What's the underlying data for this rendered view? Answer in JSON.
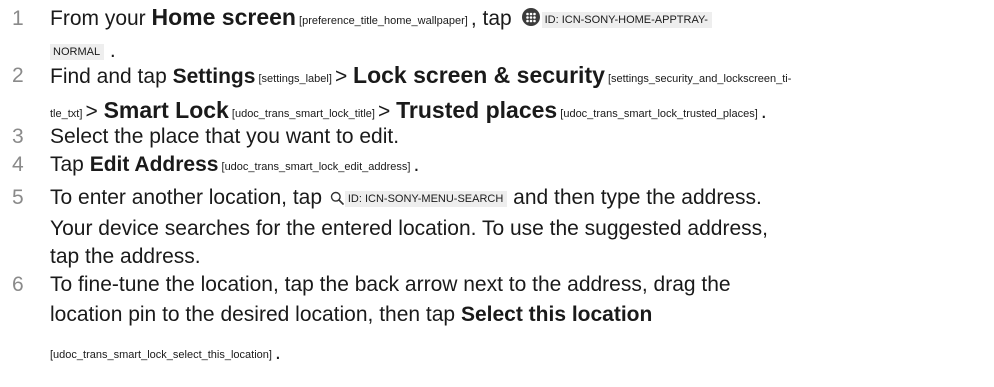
{
  "steps": [
    {
      "num": "1",
      "t1": "From your ",
      "home_screen": "Home screen",
      "home_key": " [preference_title_home_wallpaper] ",
      "t2": ", tap ",
      "apps_icon": "apps-grid-icon",
      "id_a": "ID: ICN-SONY-HOME-APPTRAY-",
      "id_b": "NORMAL",
      "t3": " ."
    },
    {
      "num": "2",
      "t1": "Find and tap ",
      "settings": "Settings",
      "settings_key": " [settings_label] ",
      "sep1": "> ",
      "lock_screen": "Lock screen & security",
      "lock_key_a": " [settings_security_and_lockscreen_ti-",
      "lock_key_b": "tle_txt] ",
      "sep2": "> ",
      "smart_lock": "Smart Lock",
      "smart_key": " [udoc_trans_smart_lock_title] ",
      "sep3": "> ",
      "trusted_places": "Trusted places",
      "trusted_key": " [udoc_trans_smart_lock_trusted_places] ",
      "end": "."
    },
    {
      "num": "3",
      "text": "Select the place that you want to edit."
    },
    {
      "num": "4",
      "t1": "Tap ",
      "edit_address": "Edit Address",
      "edit_key": " [udoc_trans_smart_lock_edit_address] ",
      "end": "."
    },
    {
      "num": "5",
      "t1": "To enter another location, tap ",
      "search_icon": "search-icon",
      "id": "ID: ICN-SONY-MENU-SEARCH",
      "t2": " and then type the address.",
      "line2": "Your device searches for the entered location. To use the suggested address,",
      "line3": "tap the address."
    },
    {
      "num": "6",
      "line1": "To fine-tune the location, tap the back arrow next to the address, drag the",
      "line2_a": "location pin to the desired location, then tap ",
      "select_location": "Select this location",
      "select_key": "[udoc_trans_smart_lock_select_this_location] ",
      "end": "."
    }
  ]
}
